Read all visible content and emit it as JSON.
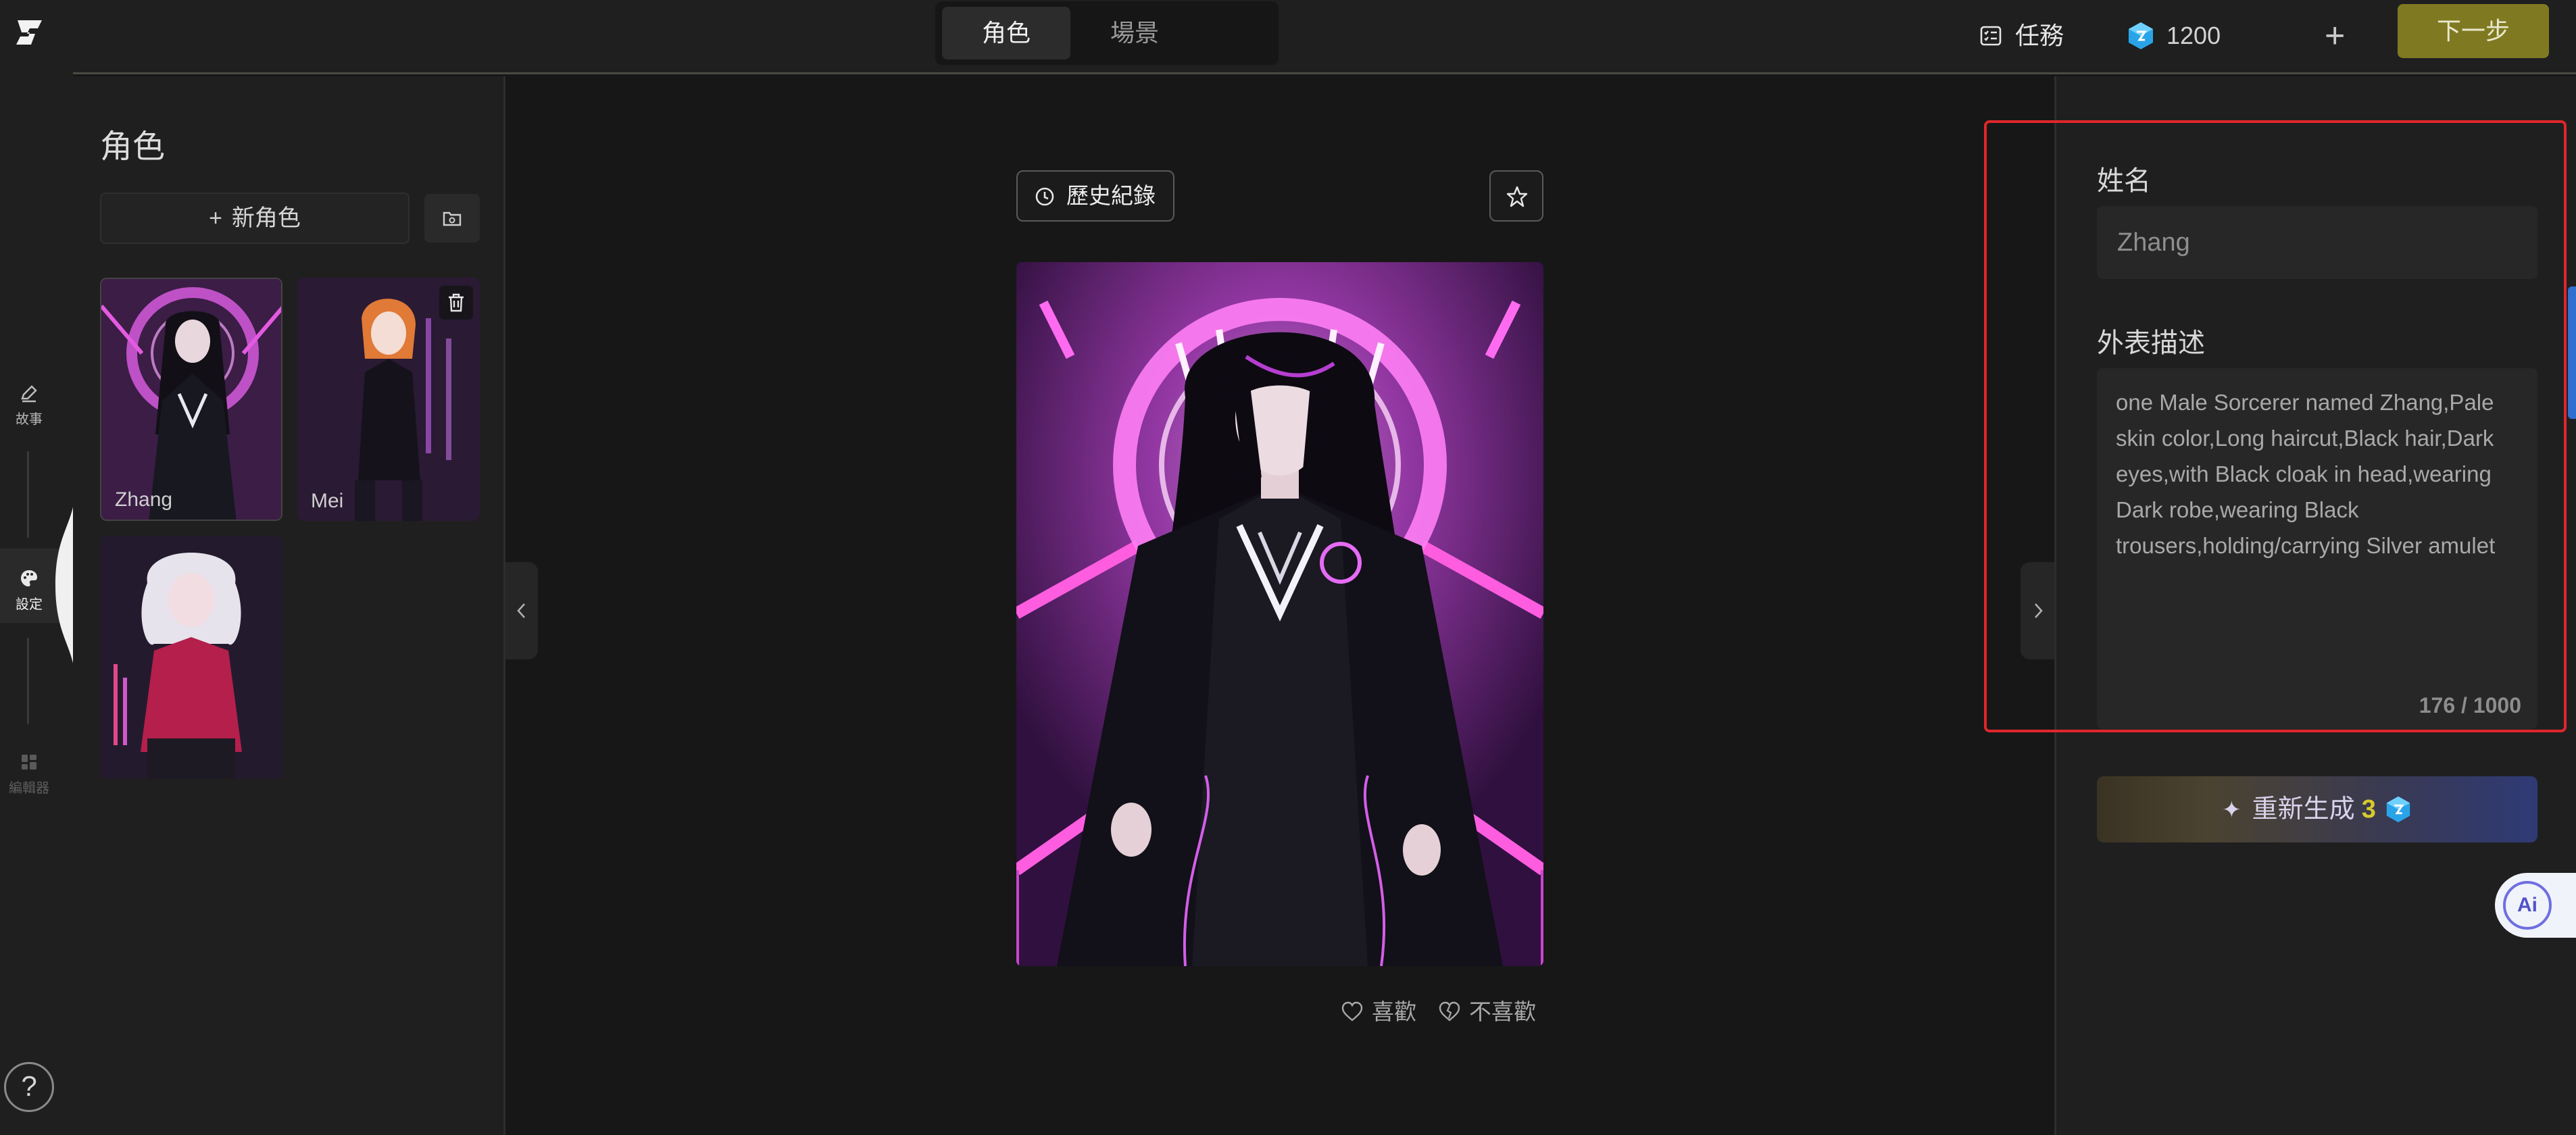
{
  "rail": {
    "items": [
      {
        "label": "故事",
        "icon": "pencil-icon"
      },
      {
        "label": "設定",
        "icon": "palette-icon"
      },
      {
        "label": "編輯器",
        "icon": "grid-icon"
      }
    ],
    "help_label": "?"
  },
  "topbar": {
    "tabs": [
      {
        "label": "角色",
        "active": true
      },
      {
        "label": "場景",
        "active": false
      }
    ],
    "task_label": "任務",
    "coin_count": "1200",
    "next_label": "下一步"
  },
  "characters": {
    "title": "角色",
    "new_label": "新角色",
    "items": [
      {
        "name": "Zhang"
      },
      {
        "name": "Mei"
      },
      {
        "name": ""
      }
    ]
  },
  "center": {
    "history_label": "歷史紀錄",
    "like_label": "喜歡",
    "dislike_label": "不喜歡"
  },
  "details": {
    "name_label": "姓名",
    "name_value": "Zhang",
    "desc_label": "外表描述",
    "desc_value": "one Male Sorcerer named Zhang,Pale skin color,Long haircut,Black hair,Dark eyes,with Black cloak in head,wearing Dark robe,wearing Black trousers,holding/carrying Silver amulet",
    "counter": "176 / 1000",
    "regen_label": "重新生成",
    "regen_cost": "3"
  },
  "ai_label": "Ai",
  "colors": {
    "accent_next": "#7f7a22",
    "highlight": "#e0262b",
    "neon": "#d04bd8"
  }
}
